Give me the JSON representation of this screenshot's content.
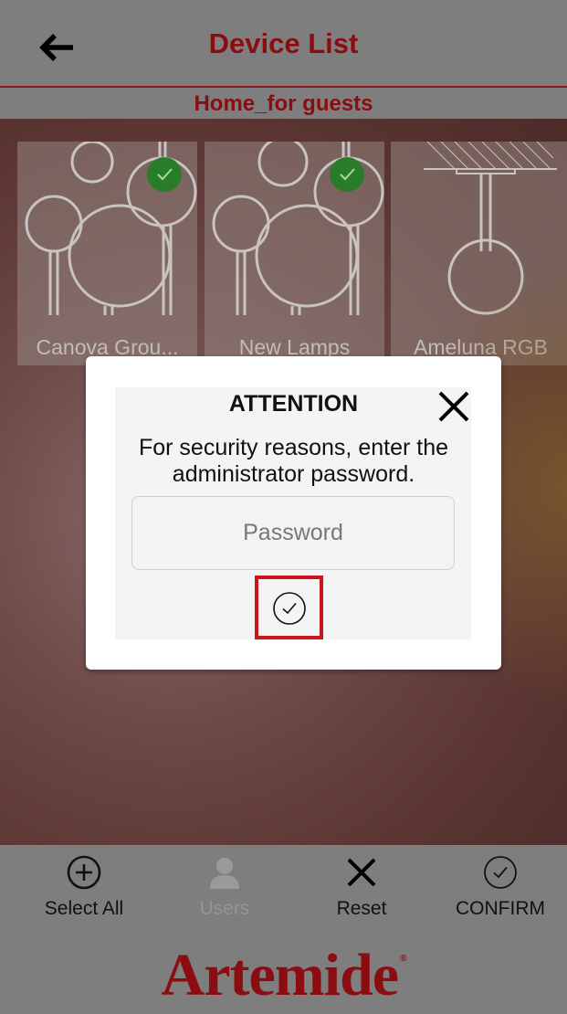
{
  "header": {
    "title": "Device List",
    "subtitle": "Home_for guests"
  },
  "devices": [
    {
      "label": "Canova Grou...",
      "selected": true
    },
    {
      "label": "New Lamps",
      "selected": true
    },
    {
      "label": "Ameluna RGB",
      "selected": false
    }
  ],
  "dialog": {
    "title": "ATTENTION",
    "message_line1": "For security reasons, enter the",
    "message_line2": "administrator password.",
    "password_placeholder": "Password"
  },
  "toolbar": {
    "select_all": "Select All",
    "users": "Users",
    "reset": "Reset",
    "confirm": "CONFIRM"
  },
  "brand": {
    "name": "Artemide",
    "mark": "®"
  },
  "colors": {
    "accent": "#8b0d12",
    "check_green": "#2a7d28",
    "highlight": "#c8151f"
  }
}
